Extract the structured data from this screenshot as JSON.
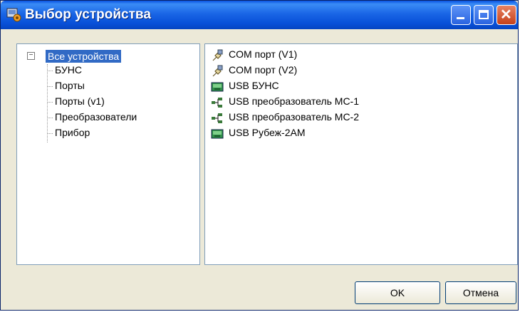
{
  "window": {
    "title": "Выбор устройства"
  },
  "tree": {
    "root": "Все устройства",
    "children": [
      "БУНС",
      "Порты",
      "Порты (v1)",
      "Преобразователи",
      "Прибор"
    ]
  },
  "devices": [
    {
      "label": "COM порт (V1)",
      "icon": "com-port-icon"
    },
    {
      "label": "COM порт (V2)",
      "icon": "com-port-icon"
    },
    {
      "label": "USB БУНС",
      "icon": "usb-device-icon"
    },
    {
      "label": "USB преобразователь МС-1",
      "icon": "usb-converter-icon"
    },
    {
      "label": "USB преобразователь МС-2",
      "icon": "usb-converter-icon"
    },
    {
      "label": "USB Рубеж-2АМ",
      "icon": "usb-device-icon"
    }
  ],
  "buttons": {
    "ok": "OK",
    "cancel": "Отмена"
  }
}
